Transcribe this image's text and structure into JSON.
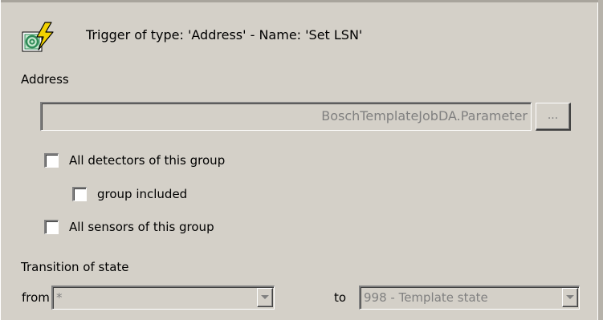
{
  "header": {
    "icon": "address-trigger-icon",
    "title": "Trigger of type: 'Address'  -  Name: 'Set LSN'"
  },
  "address": {
    "label": "Address",
    "value": "BoschTemplateJobDA.Parameter",
    "browse_label": "..."
  },
  "options": {
    "all_detectors": {
      "label": "All detectors of this group",
      "checked": false
    },
    "group_included": {
      "label": "group included",
      "checked": false
    },
    "all_sensors": {
      "label": "All sensors of this group",
      "checked": false
    }
  },
  "transition": {
    "label": "Transition of state",
    "from_label": "from",
    "from_value": "*",
    "to_label": "to",
    "to_value": "998 - Template state"
  },
  "colors": {
    "background": "#d4d0c8",
    "disabled_text": "#808080",
    "icon_green": "#2e8b57",
    "icon_yellow": "#f2d200"
  }
}
